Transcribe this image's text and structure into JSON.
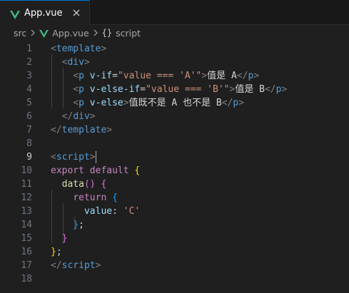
{
  "tab": {
    "label": "App.vue"
  },
  "breadcrumb": {
    "folder": "src",
    "file": "App.vue",
    "symbol": "script",
    "symbol_icon": "{}"
  },
  "editor": {
    "active_line": 9,
    "lines": [
      {
        "n": "1",
        "tokens": [
          [
            "t-punc",
            "<"
          ],
          [
            "t-tag",
            "template"
          ],
          [
            "t-punc",
            ">"
          ]
        ]
      },
      {
        "n": "2",
        "tokens": [
          [
            "t-plain",
            "  "
          ],
          [
            "t-punc",
            "<"
          ],
          [
            "t-tag",
            "div"
          ],
          [
            "t-punc",
            ">"
          ]
        ]
      },
      {
        "n": "3",
        "tokens": [
          [
            "t-plain",
            "    "
          ],
          [
            "t-punc",
            "<"
          ],
          [
            "t-tag",
            "p"
          ],
          [
            "t-plain",
            " "
          ],
          [
            "t-attr",
            "v-if"
          ],
          [
            "t-plain",
            "="
          ],
          [
            "t-str",
            "\"value === 'A'\""
          ],
          [
            "t-punc",
            ">"
          ],
          [
            "t-text",
            "值是 A"
          ],
          [
            "t-punc",
            "</"
          ],
          [
            "t-tag",
            "p"
          ],
          [
            "t-punc",
            ">"
          ]
        ]
      },
      {
        "n": "4",
        "tokens": [
          [
            "t-plain",
            "    "
          ],
          [
            "t-punc",
            "<"
          ],
          [
            "t-tag",
            "p"
          ],
          [
            "t-plain",
            " "
          ],
          [
            "t-attr",
            "v-else-if"
          ],
          [
            "t-plain",
            "="
          ],
          [
            "t-str",
            "\"value === 'B'\""
          ],
          [
            "t-punc",
            ">"
          ],
          [
            "t-text",
            "值是 B"
          ],
          [
            "t-punc",
            "</"
          ],
          [
            "t-tag",
            "p"
          ],
          [
            "t-punc",
            ">"
          ]
        ]
      },
      {
        "n": "5",
        "tokens": [
          [
            "t-plain",
            "    "
          ],
          [
            "t-punc",
            "<"
          ],
          [
            "t-tag",
            "p"
          ],
          [
            "t-plain",
            " "
          ],
          [
            "t-attr",
            "v-else"
          ],
          [
            "t-punc",
            ">"
          ],
          [
            "t-text",
            "值既不是 A 也不是 B"
          ],
          [
            "t-punc",
            "</"
          ],
          [
            "t-tag",
            "p"
          ],
          [
            "t-punc",
            ">"
          ]
        ]
      },
      {
        "n": "6",
        "tokens": [
          [
            "t-plain",
            "  "
          ],
          [
            "t-punc",
            "</"
          ],
          [
            "t-tag",
            "div"
          ],
          [
            "t-punc",
            ">"
          ]
        ]
      },
      {
        "n": "7",
        "tokens": [
          [
            "t-punc",
            "</"
          ],
          [
            "t-tag",
            "template"
          ],
          [
            "t-punc",
            ">"
          ]
        ]
      },
      {
        "n": "8",
        "tokens": []
      },
      {
        "n": "9",
        "tokens": [
          [
            "t-punc",
            "<"
          ],
          [
            "t-tag",
            "script"
          ],
          [
            "t-punc",
            ">"
          ]
        ]
      },
      {
        "n": "10",
        "tokens": [
          [
            "t-kw",
            "export"
          ],
          [
            "t-plain",
            " "
          ],
          [
            "t-kw",
            "default"
          ],
          [
            "t-plain",
            " "
          ],
          [
            "t-br1",
            "{"
          ]
        ]
      },
      {
        "n": "11",
        "tokens": [
          [
            "t-plain",
            "  "
          ],
          [
            "t-fn",
            "data"
          ],
          [
            "t-br2",
            "()"
          ],
          [
            "t-plain",
            " "
          ],
          [
            "t-br2",
            "{"
          ]
        ]
      },
      {
        "n": "12",
        "tokens": [
          [
            "t-plain",
            "    "
          ],
          [
            "t-kw",
            "return"
          ],
          [
            "t-plain",
            " "
          ],
          [
            "t-br3",
            "{"
          ]
        ]
      },
      {
        "n": "13",
        "tokens": [
          [
            "t-plain",
            "      "
          ],
          [
            "t-prop",
            "value"
          ],
          [
            "t-plain",
            ": "
          ],
          [
            "t-str",
            "'C'"
          ]
        ]
      },
      {
        "n": "14",
        "tokens": [
          [
            "t-plain",
            "    "
          ],
          [
            "t-br3",
            "}"
          ],
          [
            "t-plain",
            ";"
          ]
        ]
      },
      {
        "n": "15",
        "tokens": [
          [
            "t-plain",
            "  "
          ],
          [
            "t-br2",
            "}"
          ]
        ]
      },
      {
        "n": "16",
        "tokens": [
          [
            "t-br1",
            "}"
          ],
          [
            "t-plain",
            ";"
          ]
        ]
      },
      {
        "n": "17",
        "tokens": [
          [
            "t-punc",
            "</"
          ],
          [
            "t-tag",
            "script"
          ],
          [
            "t-punc",
            ">"
          ]
        ]
      },
      {
        "n": "18",
        "tokens": []
      }
    ]
  }
}
